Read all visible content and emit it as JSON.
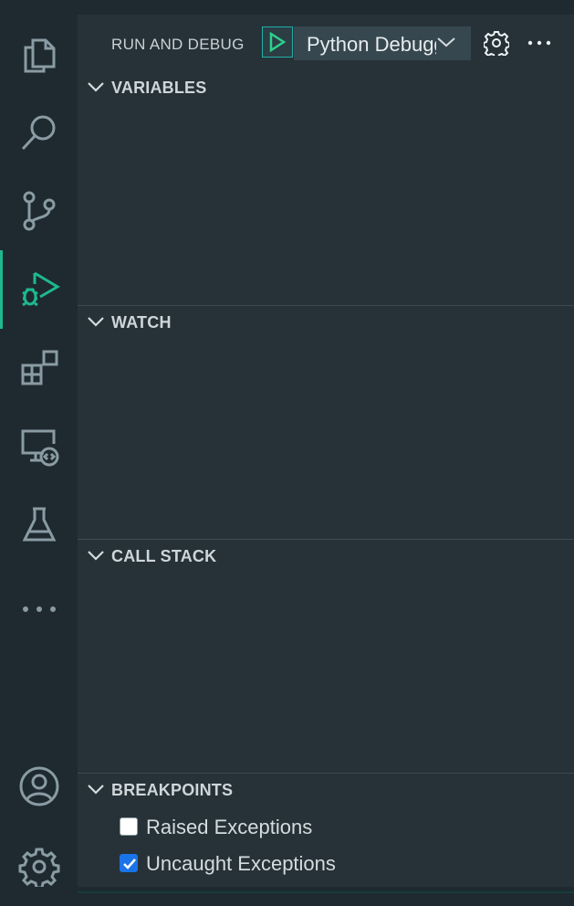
{
  "activity_bar": {
    "items": [
      {
        "icon": "files-icon"
      },
      {
        "icon": "search-icon"
      },
      {
        "icon": "source-control-icon"
      },
      {
        "icon": "run-debug-icon",
        "active": true
      },
      {
        "icon": "extensions-icon"
      },
      {
        "icon": "remote-explorer-icon"
      },
      {
        "icon": "testing-icon"
      },
      {
        "icon": "more-icon"
      }
    ],
    "bottom_items": [
      {
        "icon": "account-icon"
      },
      {
        "icon": "manage-gear-icon"
      }
    ]
  },
  "header": {
    "title": "RUN AND DEBUG",
    "selected_configuration": "Python Debugger",
    "run_icon": "play-icon",
    "settings_icon": "gear-icon",
    "more_icon": "ellipsis-icon"
  },
  "sections": {
    "variables": {
      "title": "VARIABLES"
    },
    "watch": {
      "title": "WATCH"
    },
    "call_stack": {
      "title": "CALL STACK"
    },
    "breakpoints": {
      "title": "BREAKPOINTS",
      "items": [
        {
          "label": "Raised Exceptions",
          "checked": false
        },
        {
          "label": "Uncaught Exceptions",
          "checked": true
        }
      ]
    }
  },
  "colors": {
    "accent": "#1fb890",
    "activity_bg": "#1e2a30",
    "sidebar_bg": "#263238",
    "checkbox_checked": "#1a73e8"
  }
}
